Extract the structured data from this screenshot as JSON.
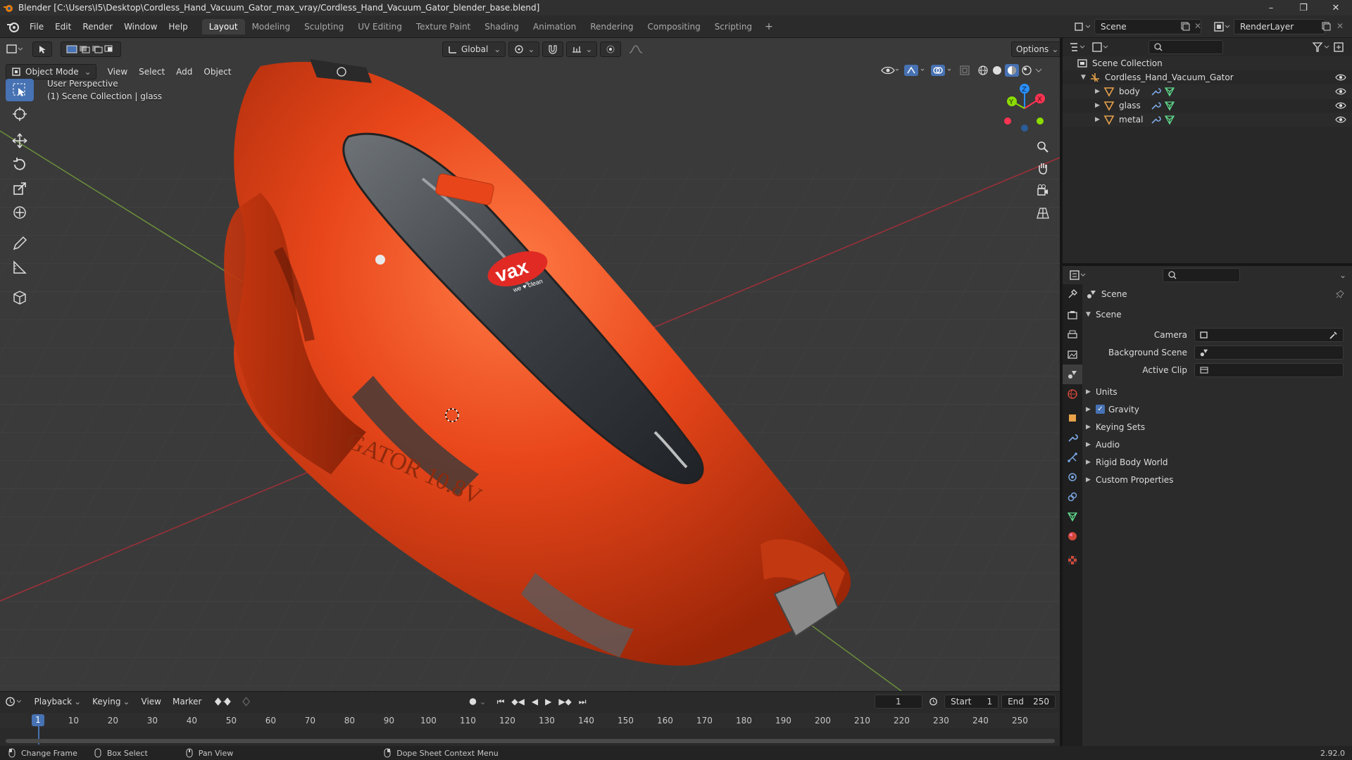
{
  "title": "Blender [C:\\Users\\I5\\Desktop\\Cordless_Hand_Vacuum_Gator_max_vray/Cordless_Hand_Vacuum_Gator_blender_base.blend]",
  "window_controls": {
    "minimize": "–",
    "maximize": "❐",
    "close": "✕"
  },
  "menu": [
    "File",
    "Edit",
    "Render",
    "Window",
    "Help"
  ],
  "workspaces": [
    "Layout",
    "Modeling",
    "Sculpting",
    "UV Editing",
    "Texture Paint",
    "Shading",
    "Animation",
    "Rendering",
    "Compositing",
    "Scripting"
  ],
  "active_workspace": "Layout",
  "scene_name": "Scene",
  "view_layer": "RenderLayer",
  "viewport": {
    "mode": "Object Mode",
    "menus": [
      "View",
      "Select",
      "Add",
      "Object"
    ],
    "transform_orientation": "Global",
    "options": "Options",
    "perspective": "User Perspective",
    "collection_info": "(1) Scene Collection | glass",
    "product_brand": "vax",
    "product_tagline": "we ♥ clean",
    "product_model": "GATOR 10.8V",
    "gizmo_axes": {
      "x": "X",
      "y": "Y",
      "z": "Z"
    },
    "axis_colors": {
      "x": "#ff3352",
      "y": "#8bdc00",
      "z": "#2890ff"
    }
  },
  "outliner": {
    "root": "Scene Collection",
    "collection": "Cordless_Hand_Vacuum_Gator",
    "objects": [
      "body",
      "glass",
      "metal"
    ]
  },
  "properties": {
    "context": "Scene",
    "panel": "Scene",
    "fields": [
      {
        "label": "Camera",
        "value": ""
      },
      {
        "label": "Background Scene",
        "value": ""
      },
      {
        "label": "Active Clip",
        "value": ""
      }
    ],
    "subpanels": [
      "Units",
      "Gravity",
      "Keying Sets",
      "Audio",
      "Rigid Body World",
      "Custom Properties"
    ],
    "gravity_checked": true
  },
  "timeline": {
    "menus": [
      "Playback",
      "Keying",
      "View",
      "Marker"
    ],
    "current_frame": "1",
    "start_label": "Start",
    "start": "1",
    "end_label": "End",
    "end": "250",
    "ticks": [
      "10",
      "20",
      "30",
      "40",
      "50",
      "60",
      "70",
      "80",
      "90",
      "100",
      "110",
      "120",
      "130",
      "140",
      "150",
      "160",
      "170",
      "180",
      "190",
      "200",
      "210",
      "220",
      "230",
      "240",
      "250"
    ],
    "playhead_frame": "1"
  },
  "status": {
    "items": [
      "Change Frame",
      "Box Select",
      "Pan View",
      "Dope Sheet Context Menu"
    ],
    "version": "2.92.0"
  },
  "colors": {
    "accent": "#4772b3",
    "body_orange": "#e8461a"
  }
}
